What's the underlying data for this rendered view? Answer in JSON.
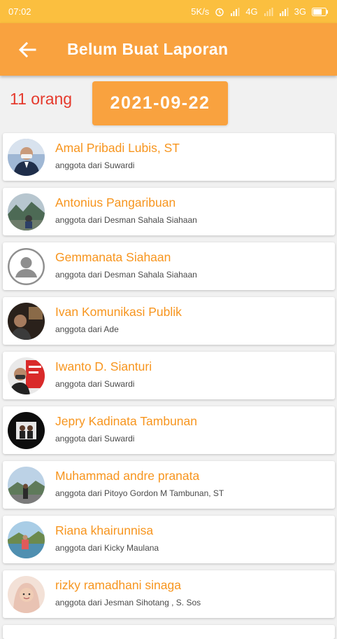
{
  "status": {
    "time": "07:02",
    "speed": "5K/s",
    "net1": "4G",
    "net2": "3G"
  },
  "header": {
    "title": "Belum Buat Laporan"
  },
  "summary": {
    "count": "11 orang",
    "date": "2021-09-22"
  },
  "members": [
    {
      "name": "Amal Pribadi Lubis, ST",
      "sub": "anggota dari Suwardi",
      "avatar": "photo-man-suit"
    },
    {
      "name": "Antonius Pangaribuan",
      "sub": "anggota dari Desman Sahala Siahaan",
      "avatar": "photo-landscape"
    },
    {
      "name": "Gemmanata Siahaan",
      "sub": "anggota dari Desman Sahala Siahaan",
      "avatar": "default-avatar"
    },
    {
      "name": "Ivan Komunikasi Publik",
      "sub": "anggota dari Ade",
      "avatar": "photo-dark-room"
    },
    {
      "name": "Iwanto D. Sianturi",
      "sub": "anggota dari Suwardi",
      "avatar": "photo-red-banner"
    },
    {
      "name": "Jepry Kadinata Tambunan",
      "sub": "anggota dari Suwardi",
      "avatar": "photo-couple"
    },
    {
      "name": "Muhammad andre pranata",
      "sub": "anggota dari Pitoyo Gordon M Tambunan, ST",
      "avatar": "photo-sky-road"
    },
    {
      "name": "Riana khairunnisa",
      "sub": "anggota dari Kicky Maulana",
      "avatar": "photo-lake"
    },
    {
      "name": "rizky ramadhani sinaga",
      "sub": "anggota dari Jesman Sihotang , S. Sos",
      "avatar": "photo-hijab-woman"
    }
  ]
}
